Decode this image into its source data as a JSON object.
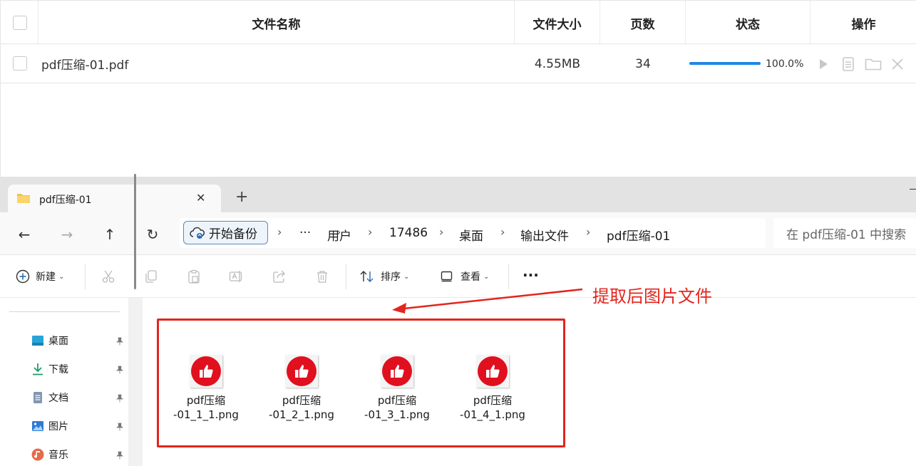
{
  "table": {
    "headers": {
      "name": "文件名称",
      "size": "文件大小",
      "pages": "页数",
      "status": "状态",
      "actions": "操作"
    },
    "rows": [
      {
        "name": "pdf压缩-01.pdf",
        "size": "4.55MB",
        "pages": "34",
        "progress": 1.0,
        "progress_label": "100.0%"
      }
    ],
    "action_icons": [
      "play-icon",
      "document-icon",
      "folder-icon",
      "close-icon"
    ],
    "accent_color": "#1e88e5"
  },
  "explorer": {
    "tab": {
      "title": "pdf压缩-01",
      "close_glyph": "✕",
      "new_tab_glyph": "+"
    },
    "nav": {
      "back_glyph": "←",
      "forward_glyph": "→",
      "up_glyph": "↑",
      "refresh_glyph": "↻"
    },
    "address": {
      "backup_label": "开始备份",
      "more_glyph": "···",
      "crumbs": [
        "用户",
        "17486",
        "桌面",
        "输出文件",
        "pdf压缩-01"
      ],
      "separator": "›"
    },
    "search_placeholder": "在 pdf压缩-01 中搜索",
    "toolbar": {
      "new_label": "新建",
      "sort_label": "排序",
      "view_label": "查看",
      "more_glyph": "···",
      "icons": [
        "cut-icon",
        "copy-icon",
        "paste-icon",
        "rename-icon",
        "share-icon",
        "delete-icon"
      ]
    },
    "sidebar": {
      "items": [
        {
          "label": "桌面",
          "icon": "desktop-icon"
        },
        {
          "label": "下载",
          "icon": "download-icon"
        },
        {
          "label": "文档",
          "icon": "document-icon"
        },
        {
          "label": "图片",
          "icon": "pictures-icon"
        },
        {
          "label": "音乐",
          "icon": "music-icon"
        }
      ]
    },
    "files": [
      {
        "line1": "pdf压缩",
        "line2": "-01_1_1.png"
      },
      {
        "line1": "pdf压缩",
        "line2": "-01_2_1.png"
      },
      {
        "line1": "pdf压缩",
        "line2": "-01_3_1.png"
      },
      {
        "line1": "pdf压缩",
        "line2": "-01_4_1.png"
      }
    ]
  },
  "annotation": {
    "text": "提取后图片文件",
    "color": "#e3251d"
  }
}
